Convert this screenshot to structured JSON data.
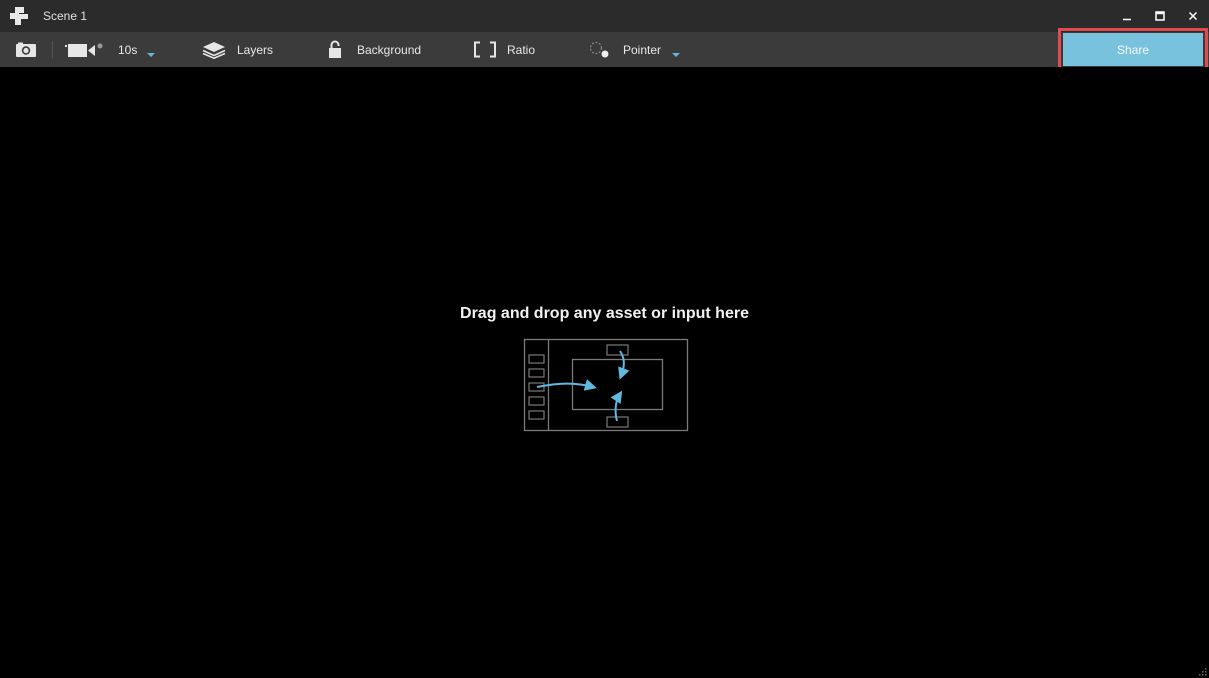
{
  "window": {
    "title": "Scene 1",
    "controls": [
      "minimize-icon",
      "maximize-icon",
      "close-icon"
    ]
  },
  "toolbar": {
    "snapshot": {
      "icon": "camera-icon"
    },
    "record": {
      "icon": "video-camera-icon",
      "duration": "10s"
    },
    "layers": {
      "icon": "layers-icon",
      "label": "Layers"
    },
    "background": {
      "icon": "padlock-icon",
      "label": "Background"
    },
    "ratio": {
      "icon": "aspect-ratio-icon",
      "label": "Ratio"
    },
    "pointer": {
      "icon": "pointer-icon",
      "label": "Pointer"
    },
    "share": {
      "label": "Share"
    }
  },
  "stage": {
    "hint": "Drag and drop any asset or input here",
    "illustration": "drag-drop-illustration-icon"
  },
  "colors": {
    "titlebar": "#2b2b2b",
    "toolbar": "#3b3b3b",
    "accent": "#5fb9e0",
    "share_button": "#78c2de",
    "highlight_border": "#e24a4f",
    "stage": "#000000"
  }
}
